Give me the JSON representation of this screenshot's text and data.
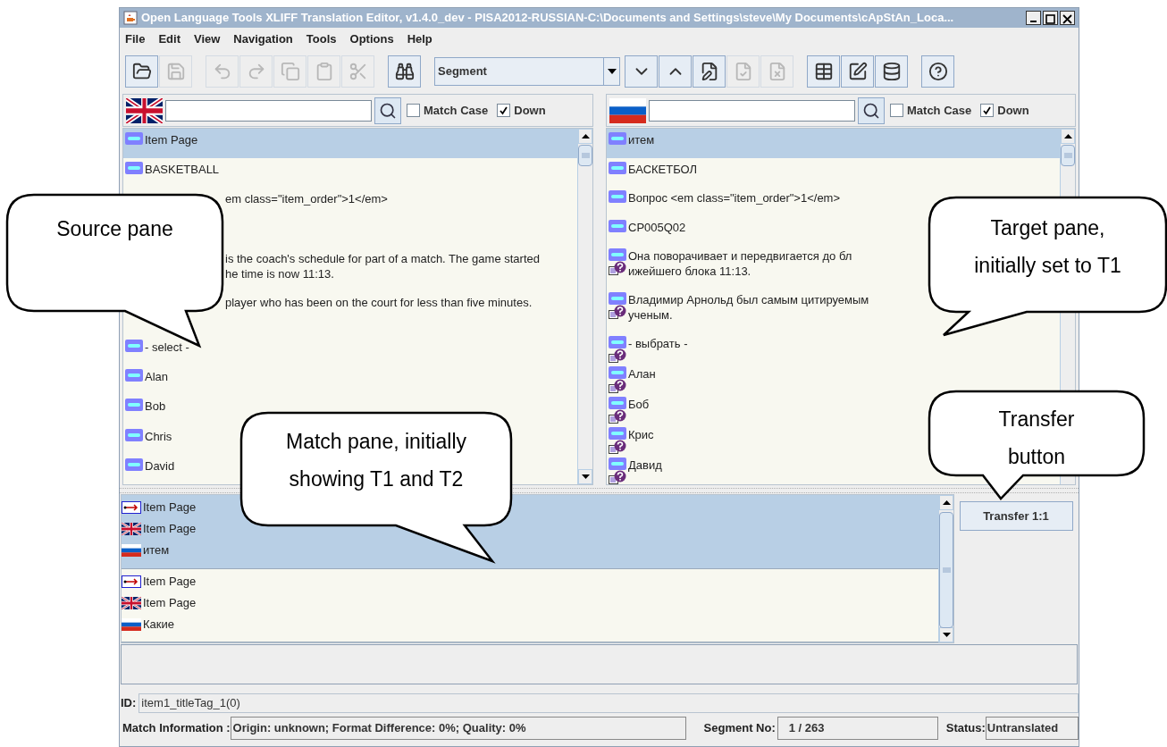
{
  "window": {
    "title": "Open Language Tools XLIFF Translation Editor, v1.4.0_dev - PISA2012-RUSSIAN-C:\\Documents and Settings\\steve\\My Documents\\cApStAn_Loca..."
  },
  "menu": [
    "File",
    "Edit",
    "View",
    "Navigation",
    "Tools",
    "Options",
    "Help"
  ],
  "toolbar": [
    [
      {
        "kind": "button",
        "disabled": false
      },
      {
        "kind": "button",
        "disabled": true
      }
    ],
    [
      {
        "kind": "button",
        "disabled": true
      },
      {
        "kind": "button",
        "disabled": true
      },
      {
        "kind": "button",
        "disabled": true
      },
      {
        "kind": "button",
        "disabled": true
      },
      {
        "kind": "button",
        "disabled": true
      }
    ],
    [
      {
        "kind": "button",
        "disabled": false
      }
    ],
    [
      {
        "kind": "combo",
        "value": "Segment"
      },
      {
        "kind": "button",
        "disabled": false
      },
      {
        "kind": "button",
        "disabled": false
      },
      {
        "kind": "button",
        "disabled": false
      },
      {
        "kind": "button",
        "disabled": true
      },
      {
        "kind": "button",
        "disabled": true
      }
    ],
    [
      {
        "kind": "button",
        "disabled": false
      },
      {
        "kind": "button",
        "disabled": false
      },
      {
        "kind": "button",
        "disabled": false
      }
    ],
    [
      {
        "kind": "button",
        "disabled": false
      }
    ]
  ],
  "source_search": {
    "match_case": {
      "label": "Match Case",
      "checked": false
    },
    "down": {
      "label": "Down",
      "checked": true
    }
  },
  "target_search": {
    "match_case": {
      "label": "Match Case",
      "checked": false
    },
    "down": {
      "label": "Down",
      "checked": true
    }
  },
  "segments": [
    {
      "selected": true,
      "source": [
        "Item Page"
      ],
      "target": [
        "итем"
      ],
      "note": false
    },
    {
      "selected": false,
      "source": [
        "BASKETBALL"
      ],
      "target": [
        "БАСКЕТБОЛ"
      ],
      "note": false
    },
    {
      "selected": false,
      "source": [
        "em class=\"item_order\">1</em>"
      ],
      "target": [
        "Вопрос <em class=\"item_order\">1</em>"
      ],
      "note": false
    },
    {
      "selected": false,
      "target": [
        "CP005Q02"
      ],
      "note": false
    },
    {
      "selected": false,
      "source": [
        "is the coach's schedule for part of a match. The game started",
        "he time is now 11:13."
      ],
      "target": [
        "Она поворачивает и передвигается до бл",
        "ижейшего блока 11:13."
      ],
      "note": true
    },
    {
      "selected": false,
      "source": [
        "player who has been on the court for less than five minutes."
      ],
      "target": [
        "Владимир Арнольд был самым цитируемым",
        "ученым."
      ],
      "note": true
    },
    {
      "selected": false,
      "source": [
        "- select -"
      ],
      "target": [
        "- выбрать -"
      ],
      "note": true
    },
    {
      "selected": false,
      "source": [
        "Alan"
      ],
      "target": [
        "Алан"
      ],
      "note": true
    },
    {
      "selected": false,
      "source": [
        "Bob"
      ],
      "target": [
        "Боб"
      ],
      "note": true
    },
    {
      "selected": false,
      "source": [
        "Chris"
      ],
      "target": [
        "Крис"
      ],
      "note": true
    },
    {
      "selected": false,
      "source": [
        "David"
      ],
      "target": [
        "Давид"
      ],
      "note": true
    }
  ],
  "matches": [
    {
      "selected": true,
      "rows": [
        {
          "kind": "tm",
          "text": "Item Page"
        },
        {
          "kind": "source",
          "text": "Item Page"
        },
        {
          "kind": "target",
          "text": "итем"
        }
      ]
    },
    {
      "selected": false,
      "rows": [
        {
          "kind": "tm",
          "text": "Item Page"
        },
        {
          "kind": "source",
          "text": "Item Page"
        },
        {
          "kind": "target",
          "text": "Какие"
        }
      ]
    }
  ],
  "transfer_button": "Transfer 1:1",
  "id_field": {
    "label": "ID:",
    "value": "item1_titleTag_1(0)"
  },
  "status_bar": {
    "match_label": "Match Information :",
    "match_value": "Origin: unknown; Format Difference: 0%; Quality: 0%",
    "segment_label": "Segment No:",
    "segment_value": "1 / 263",
    "status_label": "Status:",
    "status_value": "Untranslated"
  },
  "callouts": [
    {
      "text": "Source pane"
    },
    {
      "text": "Target pane, initially set to T1"
    },
    {
      "text": "Match pane, initially showing T1 and T2"
    },
    {
      "text": "Transfer button"
    }
  ]
}
